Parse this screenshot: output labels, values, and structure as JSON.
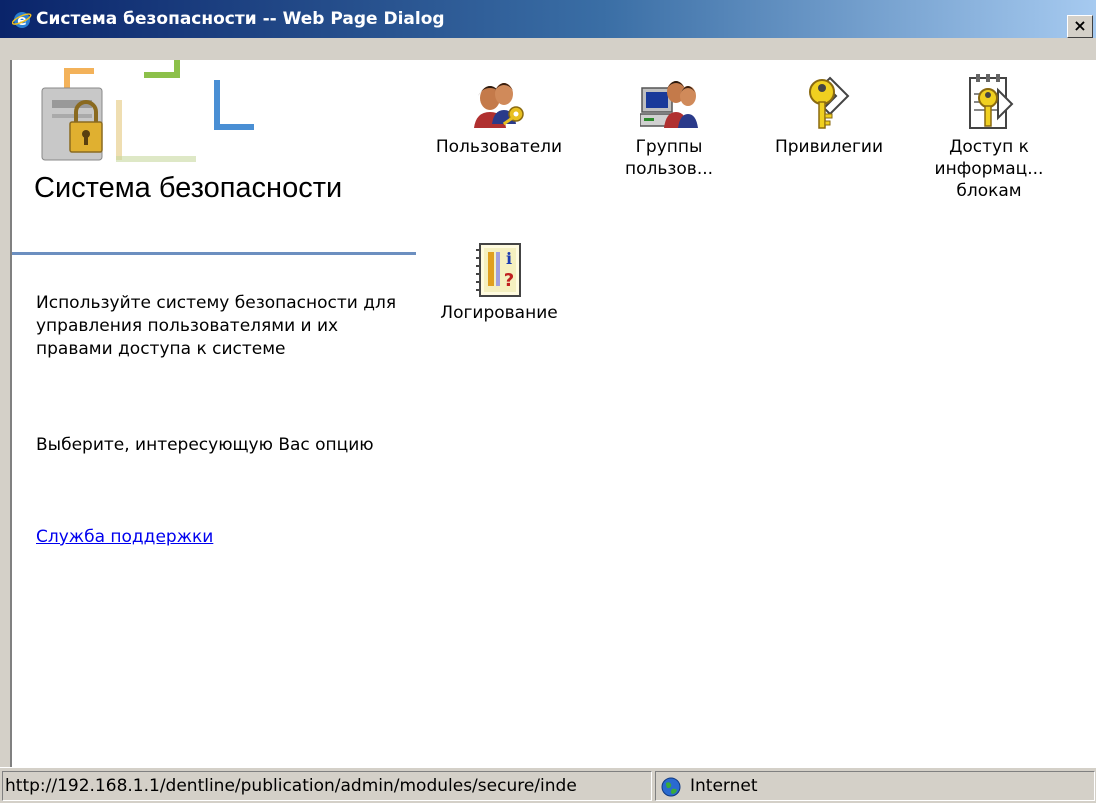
{
  "window": {
    "title": "Система безопасности -- Web Page Dialog",
    "close_label": "×"
  },
  "sidebar": {
    "title": "Система безопасности",
    "description": "Используйте систему безопасности для управления пользователями и их правами доступа к системе",
    "choose_text": "Выберите, интересующую Вас опцию",
    "support_link": "Служба поддержки"
  },
  "icons": [
    {
      "label": "Пользователи",
      "icon": "users-key-icon"
    },
    {
      "label": "Группы пользов...",
      "icon": "user-groups-icon"
    },
    {
      "label": "Привилегии",
      "icon": "privileges-key-icon"
    },
    {
      "label": "Доступ к информац... блокам",
      "icon": "info-block-access-icon"
    },
    {
      "label": "Логирование",
      "icon": "logging-notebook-icon"
    }
  ],
  "statusbar": {
    "url": "http://192.168.1.1/dentline/publication/admin/modules/secure/inde",
    "zone": "Internet"
  },
  "colors": {
    "titlebar_start": "#0a246a",
    "titlebar_end": "#a6caf0",
    "link": "#0000ee",
    "divider": "#6c8fc0",
    "chrome": "#d4d0c8"
  }
}
